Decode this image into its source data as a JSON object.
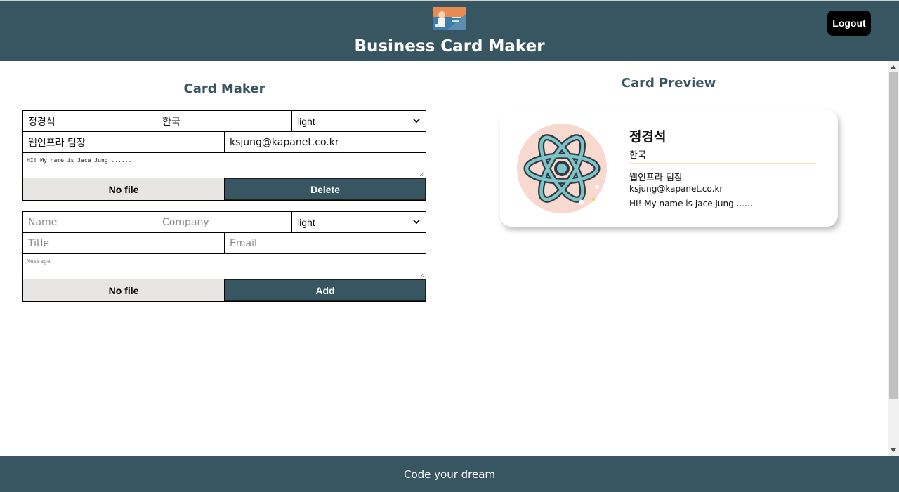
{
  "header": {
    "title": "Business Card Maker",
    "logout_label": "Logout",
    "logo_icon": "business-card-logo-icon"
  },
  "maker": {
    "title": "Card Maker",
    "cards": [
      {
        "name": "정경석",
        "company": "한국",
        "theme": "light",
        "job_title": "웹인프라 팀장",
        "email": "ksjung@kapanet.co.kr",
        "message": "HI! My name is Jace Jung ......",
        "file_label": "No file",
        "action_label": "Delete"
      }
    ],
    "add_form": {
      "name_placeholder": "Name",
      "company_placeholder": "Company",
      "theme": "light",
      "title_placeholder": "Title",
      "email_placeholder": "Email",
      "message_placeholder": "Message",
      "file_label": "No file",
      "action_label": "Add"
    }
  },
  "preview": {
    "title": "Card Preview",
    "card": {
      "name": "정경석",
      "company": "한국",
      "job_title": "웹인프라 팀장",
      "email": "ksjung@kapanet.co.kr",
      "message": "HI! My name is Jace Jung ......",
      "avatar_icon": "atom-icon"
    }
  },
  "footer": {
    "text": "Code your dream"
  },
  "colors": {
    "primary": "#385562",
    "file_button_bg": "#e8e6e4",
    "avatar_bg": "#f8d9d0",
    "card_divider": "#f2e3b8"
  }
}
